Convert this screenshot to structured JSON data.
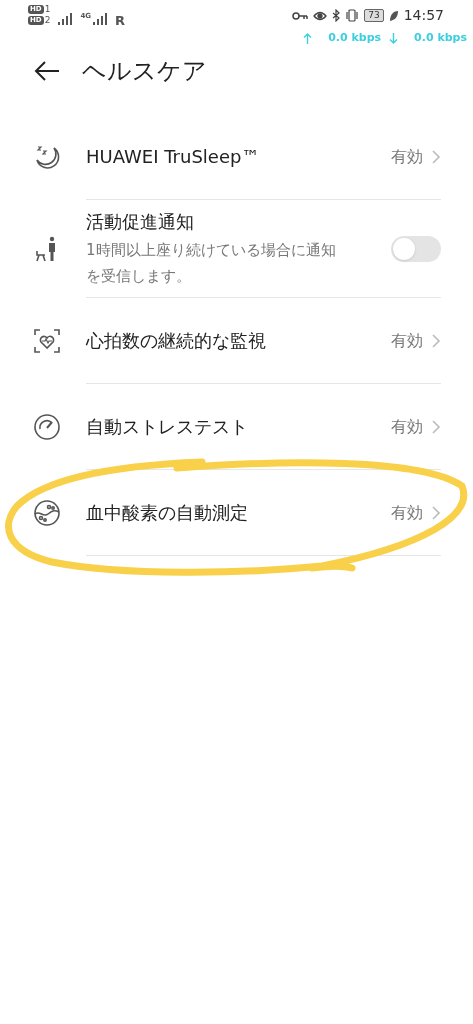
{
  "status_bar": {
    "hd_badges": [
      {
        "label": "HD",
        "slot": "1"
      },
      {
        "label": "HD",
        "slot": "2"
      }
    ],
    "network": "4G",
    "roaming": "R",
    "battery": "73",
    "time": "14:57",
    "upload": "0.0 kbps",
    "download": "0.0 kbps"
  },
  "header": {
    "title": "ヘルスケア"
  },
  "items": [
    {
      "kind": "link",
      "title": "HUAWEI TruSleep™",
      "value": "有効"
    },
    {
      "kind": "toggle",
      "title": "活動促進通知",
      "subtitle": "1時間以上座り続けている場合に通知を受信します。",
      "on": false
    },
    {
      "kind": "link",
      "title": "心拍数の継続的な監視",
      "value": "有効"
    },
    {
      "kind": "link",
      "title": "自動ストレステスト",
      "value": "有効"
    },
    {
      "kind": "link",
      "title": "血中酸素の自動測定",
      "value": "有効"
    }
  ]
}
